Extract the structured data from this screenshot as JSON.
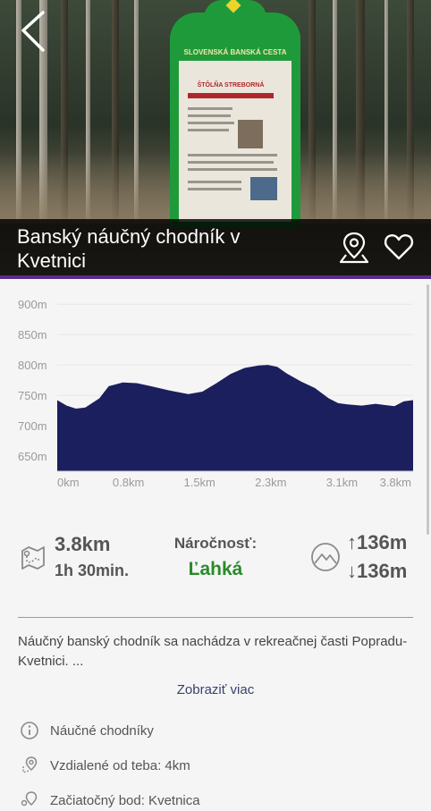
{
  "header": {
    "title": "Banský náučný chodník v Kvetnici"
  },
  "sign": {
    "heading": "SLOVENSKÁ BANSKÁ CESTA",
    "subheading": "ŠTÔLŇA STREBORNÁ"
  },
  "chart_data": {
    "type": "area",
    "title": "",
    "xlabel": "",
    "ylabel": "",
    "y_ticks": [
      "900m",
      "850m",
      "800m",
      "750m",
      "700m",
      "650m"
    ],
    "x_ticks": [
      "0km",
      "0.8km",
      "1.5km",
      "2.3km",
      "3.1km",
      "3.8km"
    ],
    "ylim": [
      625,
      915
    ],
    "xlim": [
      0,
      3.8
    ],
    "fill_color": "#1c1f5e",
    "x": [
      0.0,
      0.1,
      0.2,
      0.3,
      0.45,
      0.55,
      0.7,
      0.85,
      1.0,
      1.2,
      1.4,
      1.55,
      1.7,
      1.85,
      2.0,
      2.15,
      2.25,
      2.35,
      2.45,
      2.6,
      2.75,
      2.9,
      3.0,
      3.1,
      3.25,
      3.4,
      3.5,
      3.6,
      3.7,
      3.8
    ],
    "y": [
      742,
      733,
      728,
      730,
      745,
      765,
      771,
      770,
      765,
      758,
      752,
      756,
      770,
      785,
      795,
      799,
      800,
      797,
      786,
      773,
      762,
      745,
      737,
      735,
      733,
      736,
      734,
      732,
      740,
      742
    ]
  },
  "stats": {
    "distance": "3.8km",
    "duration": "1h 30min.",
    "difficulty_label": "Náročnosť:",
    "difficulty_value": "Ľahká",
    "difficulty_color": "#2a8a2a",
    "ascent": "↑136m",
    "descent": "↓136m"
  },
  "description": {
    "text": "Náučný banský chodník sa nachádza v rekreačnej časti Popradu- Kvetnici. ...",
    "show_more": "Zobraziť viac"
  },
  "info": {
    "category": "Náučné chodníky",
    "distance_from_you": "Vzdialené od teba: 4km",
    "start_point": "Začiatočný bod: Kvetnica"
  },
  "colors": {
    "accent": "#5a2a8c",
    "chart_fill": "#1c1f5e"
  }
}
